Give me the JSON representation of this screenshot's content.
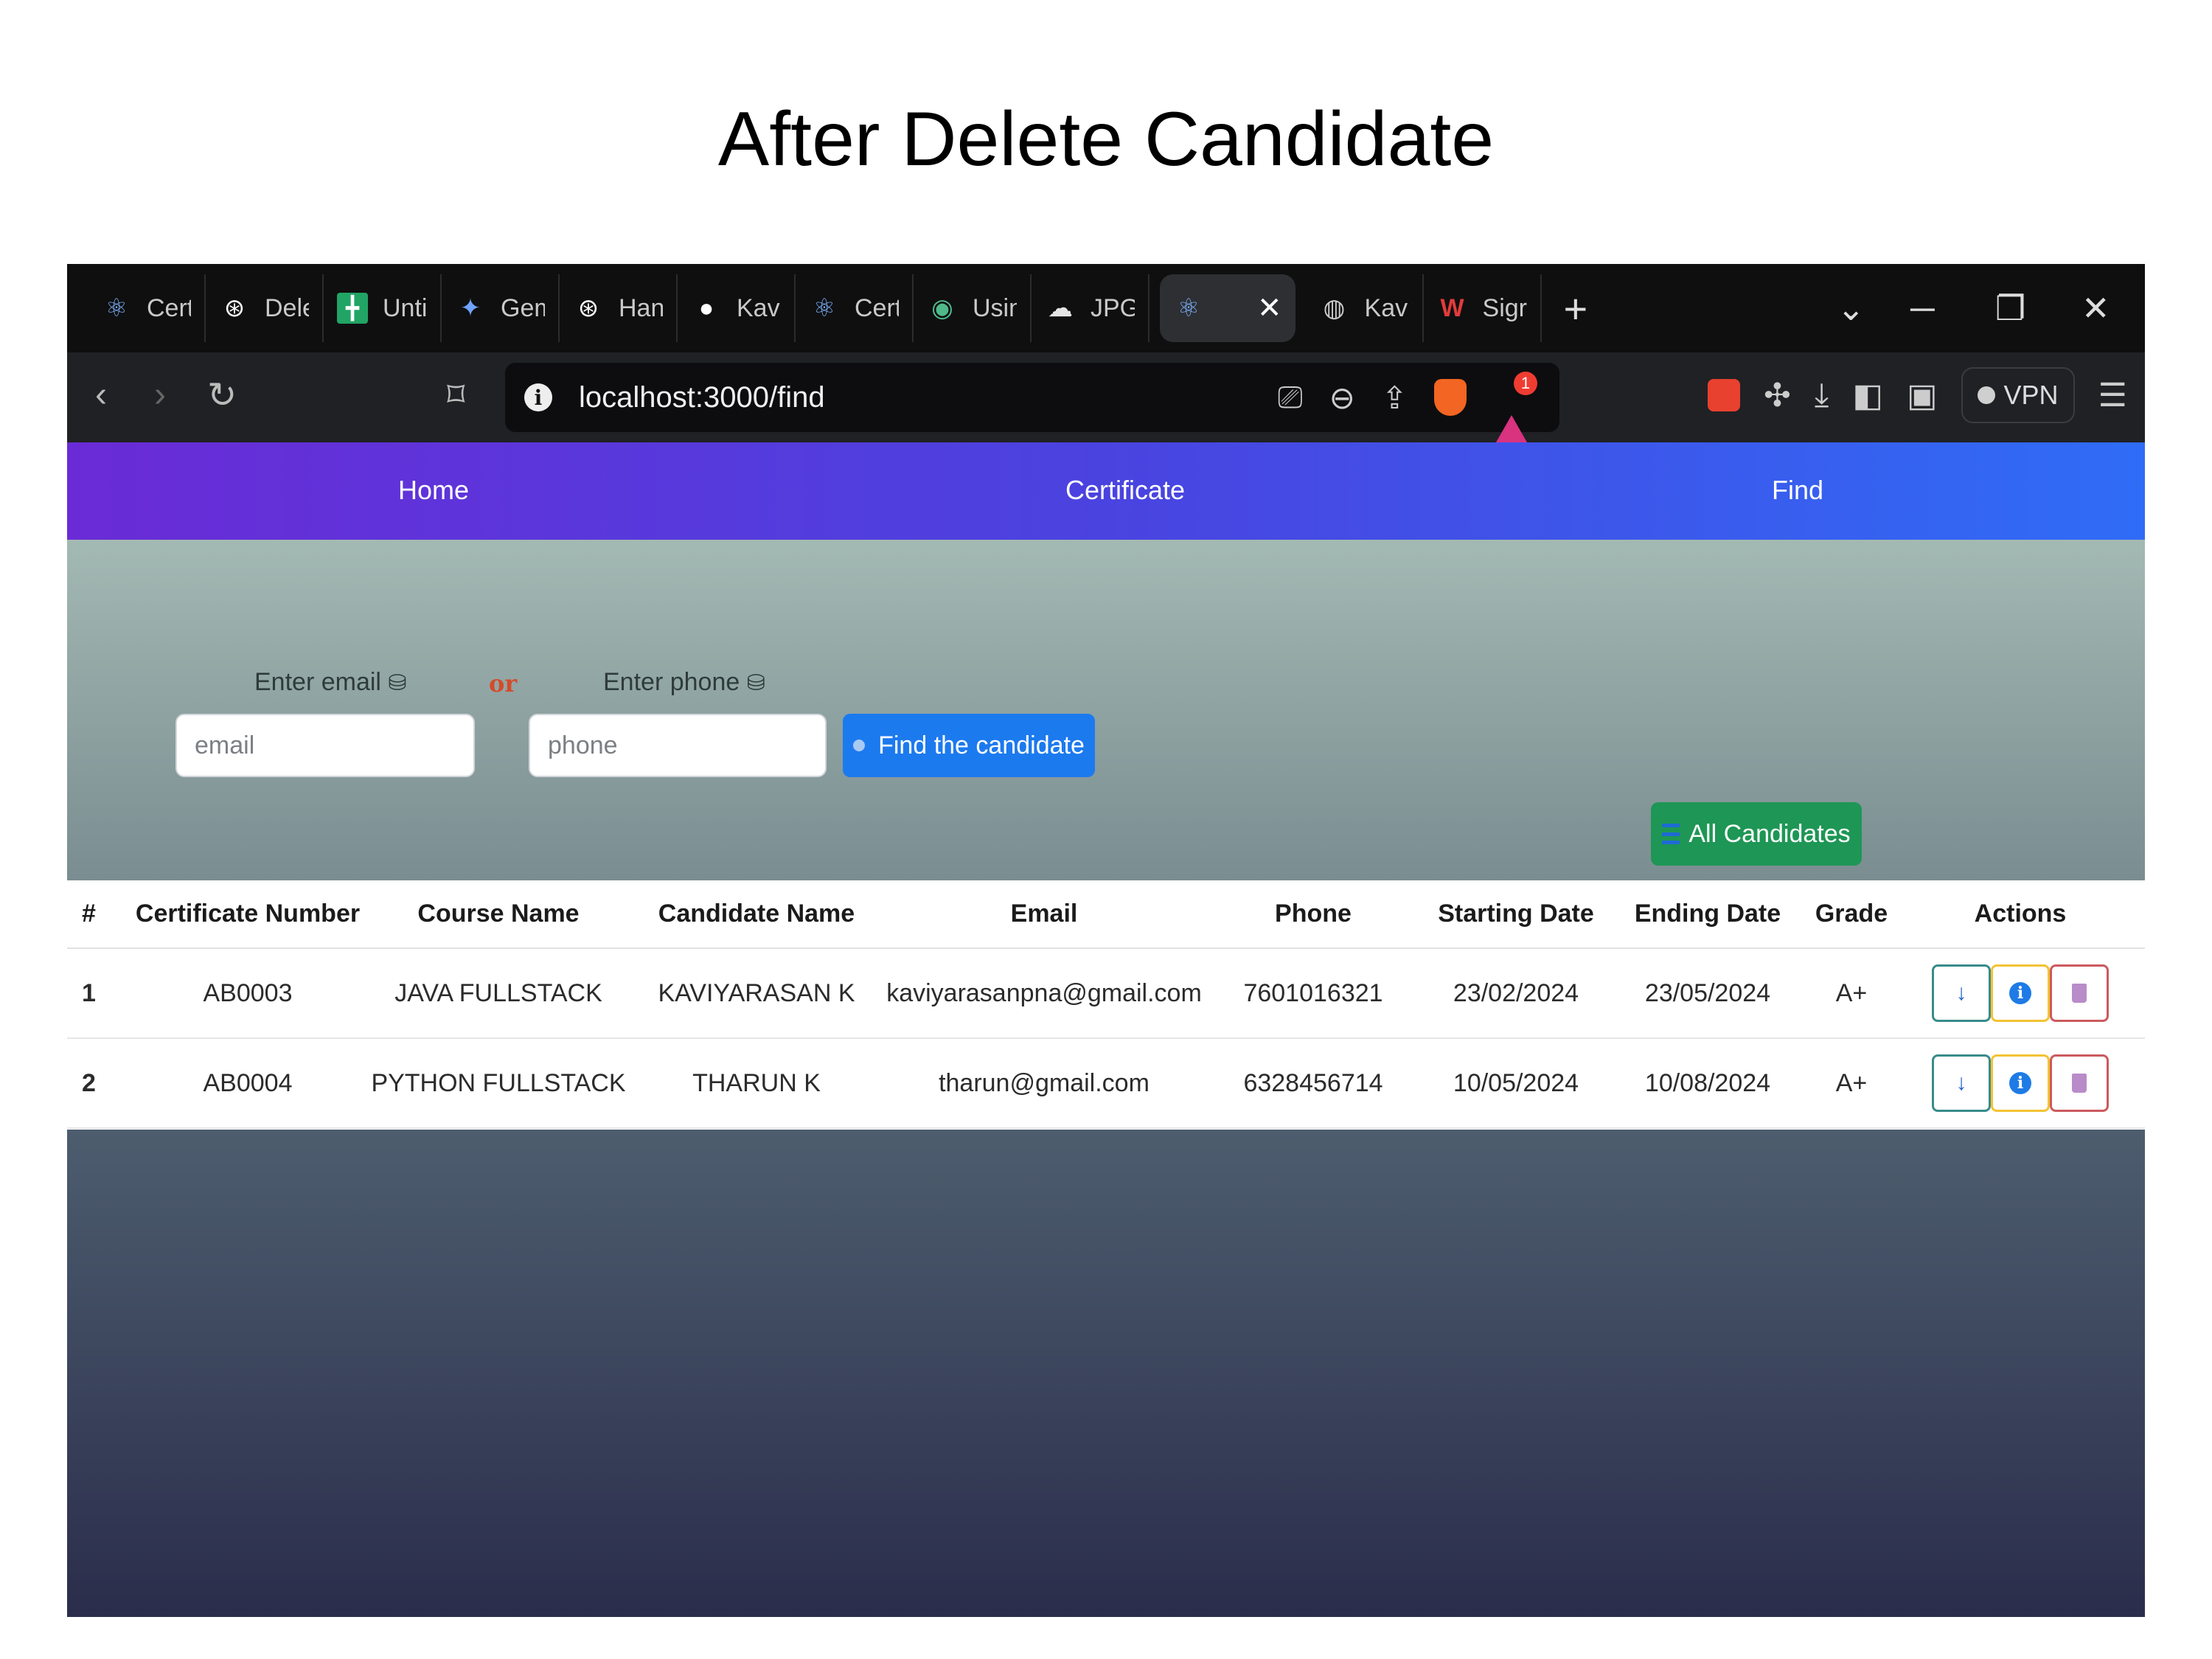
{
  "slide": {
    "title": "After Delete Candidate"
  },
  "browser": {
    "tabs": [
      {
        "label": "Cert",
        "icon": "react-icon"
      },
      {
        "label": "Dele",
        "icon": "chatgpt-icon"
      },
      {
        "label": "Unti",
        "icon": "sheets-icon"
      },
      {
        "label": "Gem",
        "icon": "gemini-icon"
      },
      {
        "label": "Han",
        "icon": "chatgpt-icon"
      },
      {
        "label": "Kavi",
        "icon": "github-icon"
      },
      {
        "label": "Cert",
        "icon": "react-icon"
      },
      {
        "label": "Usin",
        "icon": "shield-icon"
      },
      {
        "label": "JPG",
        "icon": "cloud-icon"
      },
      {
        "label": "",
        "icon": "react-icon",
        "active": true
      },
      {
        "label": "Kavi",
        "icon": "globe-icon"
      },
      {
        "label": "Sigr",
        "icon": "wps-icon"
      }
    ],
    "new_tab_glyph": "+",
    "url": "localhost:3000/find",
    "vpn_label": "VPN",
    "alert_count": "1"
  },
  "nav": {
    "home": "Home",
    "certificate": "Certificate",
    "find": "Find"
  },
  "search": {
    "email_label": "Enter email",
    "or_label": "or",
    "phone_label": "Enter phone",
    "email_placeholder": "email",
    "phone_placeholder": "phone",
    "find_button": "Find the candidate",
    "all_button": "All Candidates"
  },
  "table": {
    "headers": [
      "#",
      "Certificate Number",
      "Course Name",
      "Candidate Name",
      "Email",
      "Phone",
      "Starting Date",
      "Ending Date",
      "Grade",
      "Actions"
    ],
    "rows": [
      [
        "1",
        "AB0003",
        "JAVA FULLSTACK",
        "KAVIYARASAN K",
        "kaviyarasanpna@gmail.com",
        "7601016321",
        "23/02/2024",
        "23/05/2024",
        "A+"
      ],
      [
        "2",
        "AB0004",
        "PYTHON FULLSTACK",
        "THARUN K",
        "tharun@gmail.com",
        "6328456714",
        "10/05/2024",
        "10/08/2024",
        "A+"
      ]
    ]
  },
  "colors": {
    "nav_start": "#6a2bd6",
    "nav_end": "#2f6cf6",
    "find_button": "#1c7aef",
    "all_button": "#1e9655"
  }
}
